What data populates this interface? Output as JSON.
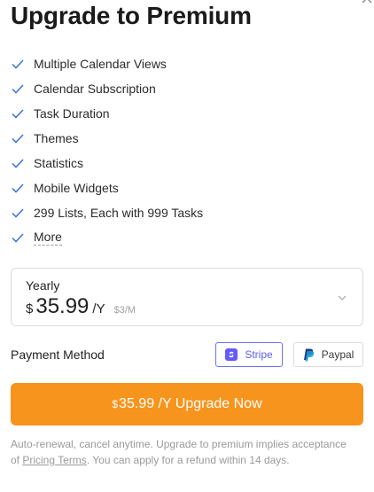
{
  "dialog": {
    "title": "Upgrade to Premium"
  },
  "features": [
    {
      "label": "Multiple Calendar Views"
    },
    {
      "label": "Calendar Subscription"
    },
    {
      "label": "Task Duration"
    },
    {
      "label": "Themes"
    },
    {
      "label": "Statistics"
    },
    {
      "label": "Mobile Widgets"
    },
    {
      "label": "299 Lists, Each with 999 Tasks"
    }
  ],
  "more_label": "More",
  "plan": {
    "name": "Yearly",
    "currency": "$",
    "amount": "35.99",
    "period": "/Y",
    "monthly": "$3/M"
  },
  "payment": {
    "label": "Payment Method",
    "stripe_label": "Stripe",
    "paypal_label": "Paypal"
  },
  "upgrade": {
    "currency": "$",
    "text": "35.99 /Y Upgrade Now"
  },
  "footnote": {
    "part1": "Auto-renewal, cancel anytime. Upgrade to premium implies acceptance of ",
    "link": "Pricing Terms",
    "part2": ". You can apply for a refund within 14 days."
  },
  "colors": {
    "accent": "#f7941d",
    "check": "#3b6fe0",
    "stripe": "#635bff",
    "paypal_dark": "#253b80",
    "paypal_light": "#179bd7"
  },
  "icons": [
    "close-icon",
    "check-icon",
    "chevron-down-icon",
    "stripe-icon",
    "paypal-icon"
  ]
}
